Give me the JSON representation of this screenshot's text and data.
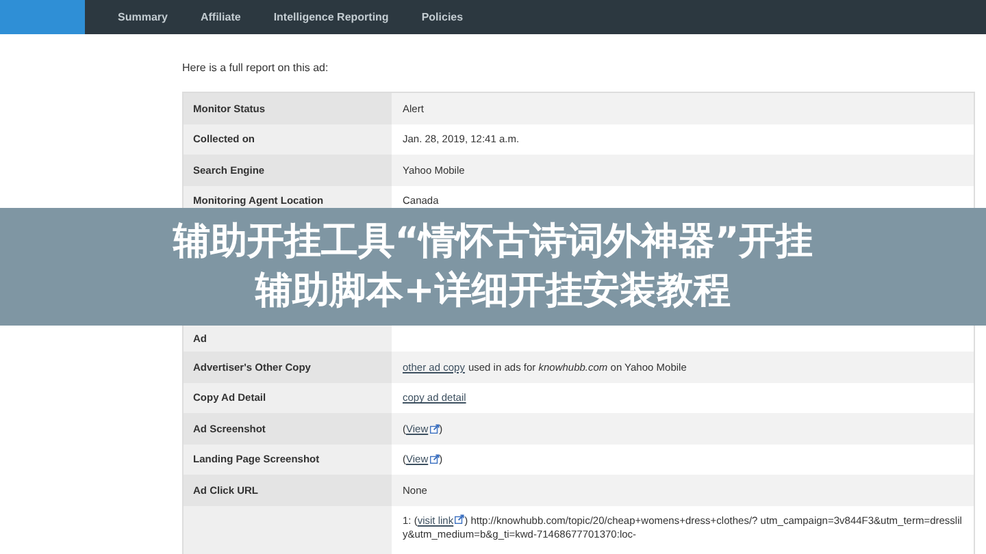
{
  "nav": {
    "items": [
      {
        "label": "Summary",
        "selected": false
      },
      {
        "label": "Affiliate",
        "selected": false
      },
      {
        "label": "Intelligence Reporting",
        "selected": false
      },
      {
        "label": "Policies",
        "selected": false
      }
    ]
  },
  "intro": "Here is a full report on this ad:",
  "report_rows": [
    {
      "kind": "row",
      "label": "Monitor Status",
      "value": [
        {
          "kind": "text",
          "text": "Alert"
        }
      ]
    },
    {
      "kind": "row",
      "label": "Collected on",
      "value": [
        {
          "kind": "text",
          "text": "Jan. 28, 2019, 12:41 a.m."
        }
      ]
    },
    {
      "kind": "row",
      "label": "Search Engine",
      "value": [
        {
          "kind": "text",
          "text": "Yahoo Mobile"
        }
      ]
    },
    {
      "kind": "row",
      "label": "Monitoring Agent Location",
      "value": [
        {
          "kind": "text",
          "text": "Canada"
        }
      ]
    },
    {
      "kind": "covered"
    },
    {
      "kind": "tall",
      "label": "Ad",
      "value": []
    },
    {
      "kind": "row",
      "label": "Advertiser's Other Copy",
      "value": [
        {
          "kind": "link",
          "text": "other ad copy"
        },
        {
          "kind": "text",
          "text": " used in ads for *knowhubb.com* on Yahoo Mobile"
        }
      ]
    },
    {
      "kind": "row",
      "label": "Copy Ad Detail",
      "value": [
        {
          "kind": "link",
          "text": "copy ad detail"
        }
      ]
    },
    {
      "kind": "row",
      "label": "Ad Screenshot",
      "value": [
        {
          "kind": "text",
          "text": "("
        },
        {
          "kind": "link",
          "text": "View"
        },
        {
          "kind": "ext"
        },
        {
          "kind": "text",
          "text": ")"
        }
      ]
    },
    {
      "kind": "row",
      "label": "Landing Page Screenshot",
      "value": [
        {
          "kind": "text",
          "text": "("
        },
        {
          "kind": "link",
          "text": "View"
        },
        {
          "kind": "ext"
        },
        {
          "kind": "text",
          "text": ")"
        }
      ]
    },
    {
      "kind": "row",
      "label": "Ad Click URL",
      "value": [
        {
          "kind": "text",
          "text": "None"
        }
      ]
    },
    {
      "kind": "url",
      "value": [
        {
          "kind": "text",
          "text": "1: ("
        },
        {
          "kind": "link",
          "text": "visit link"
        },
        {
          "kind": "ext"
        },
        {
          "kind": "text",
          "text": ") http://knowhubb.com/topic/20/cheap+womens+dress+clothes/? utm_campaign=3v844F3&utm_term=dresslily&utm_medium=b&g_ti=kwd-71468677701370:loc-"
        }
      ]
    }
  ],
  "caption_banner": {
    "lines": [
      "辅助开挂工具“情怀古诗词外神器”开挂",
      "辅助脚本+详细开挂安装教程"
    ]
  }
}
